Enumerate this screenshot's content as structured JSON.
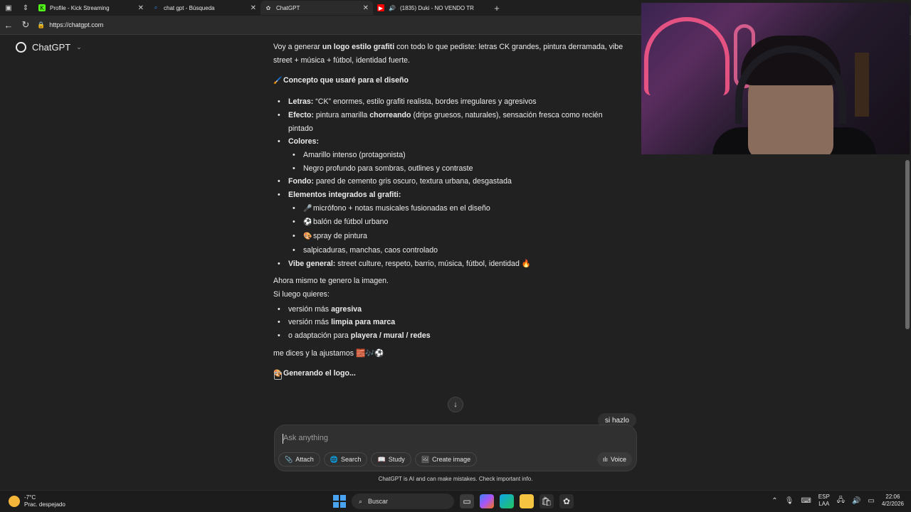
{
  "browser": {
    "tabs": [
      {
        "title": "Profile - Kick Streaming",
        "favicon": "kick-icon",
        "color": "#53fc18"
      },
      {
        "title": "chat gpt - Búsqueda",
        "favicon": "search-icon",
        "color": "#3b82f6"
      },
      {
        "title": "ChatGPT",
        "favicon": "chatgpt-icon",
        "color": "#cccccc",
        "active": true
      },
      {
        "title": "(1835) Duki - NO VENDO TR",
        "favicon": "youtube-icon",
        "color": "#ff0000"
      }
    ],
    "url": "https://chatgpt.com"
  },
  "app": {
    "brand": "ChatGPT"
  },
  "message": {
    "intro_pre": "Voy a generar ",
    "intro_bold": "un logo estilo grafiti",
    "intro_post": " con todo lo que pediste: letras CK grandes, pintura derramada, vibe street + música + fútbol, identidad fuerte.",
    "concept_emoji": "🖌️",
    "concept_title": "Concepto que usaré para el diseño",
    "items": {
      "letras_label": "Letras:",
      "letras_text": " “CK” enormes, estilo grafiti realista, bordes irregulares y agresivos",
      "efecto_label": "Efecto:",
      "efecto_text1": " pintura amarilla ",
      "efecto_bold": "chorreando",
      "efecto_text2": " (drips gruesos, naturales), sensación fresca como recién pintado",
      "colores_label": "Colores:",
      "color1": "Amarillo intenso (protagonista)",
      "color2": "Negro profundo para sombras, outlines y contraste",
      "fondo_label": "Fondo:",
      "fondo_text": " pared de cemento gris oscuro, textura urbana, desgastada",
      "elementos_label": "Elementos integrados al grafiti:",
      "el1_emoji": "🎤",
      "el1": "micrófono + notas musicales fusionadas en el diseño",
      "el2_emoji": "⚽",
      "el2": "balón de fútbol urbano",
      "el3_emoji": "🎨",
      "el3": "spray de pintura",
      "el4": "salpicaduras, manchas, caos controlado",
      "vibe_label": "Vibe general:",
      "vibe_text": " street culture, respeto, barrio, música, fútbol, identidad ",
      "vibe_emoji": "🔥"
    },
    "now": "Ahora mismo te genero la imagen.",
    "if_later": "Si luego quieres:",
    "opt1_pre": "versión más ",
    "opt1_bold": "agresiva",
    "opt2_pre": "versión más ",
    "opt2_bold": "limpia para marca",
    "opt3_pre": "o adaptación para ",
    "opt3_bold": "playera / mural / redes",
    "tell_me": "me dices y la ajustamos ",
    "tell_emojis": "🧱🎶⚽",
    "generating_emoji": "🎨",
    "generating": "Generando el logo..."
  },
  "user_message": "si hazlo",
  "composer": {
    "placeholder": "Ask anything",
    "attach": "Attach",
    "search": "Search",
    "study": "Study",
    "create_image": "Create image",
    "voice": "Voice"
  },
  "disclaimer": "ChatGPT is AI and can make mistakes. Check important info.",
  "taskbar": {
    "temp": "-7°C",
    "weather": "Prac. despejado",
    "search": "Buscar",
    "lang1": "ESP",
    "lang2": "LAA",
    "time": "22:06",
    "date": "4/2/2026"
  }
}
